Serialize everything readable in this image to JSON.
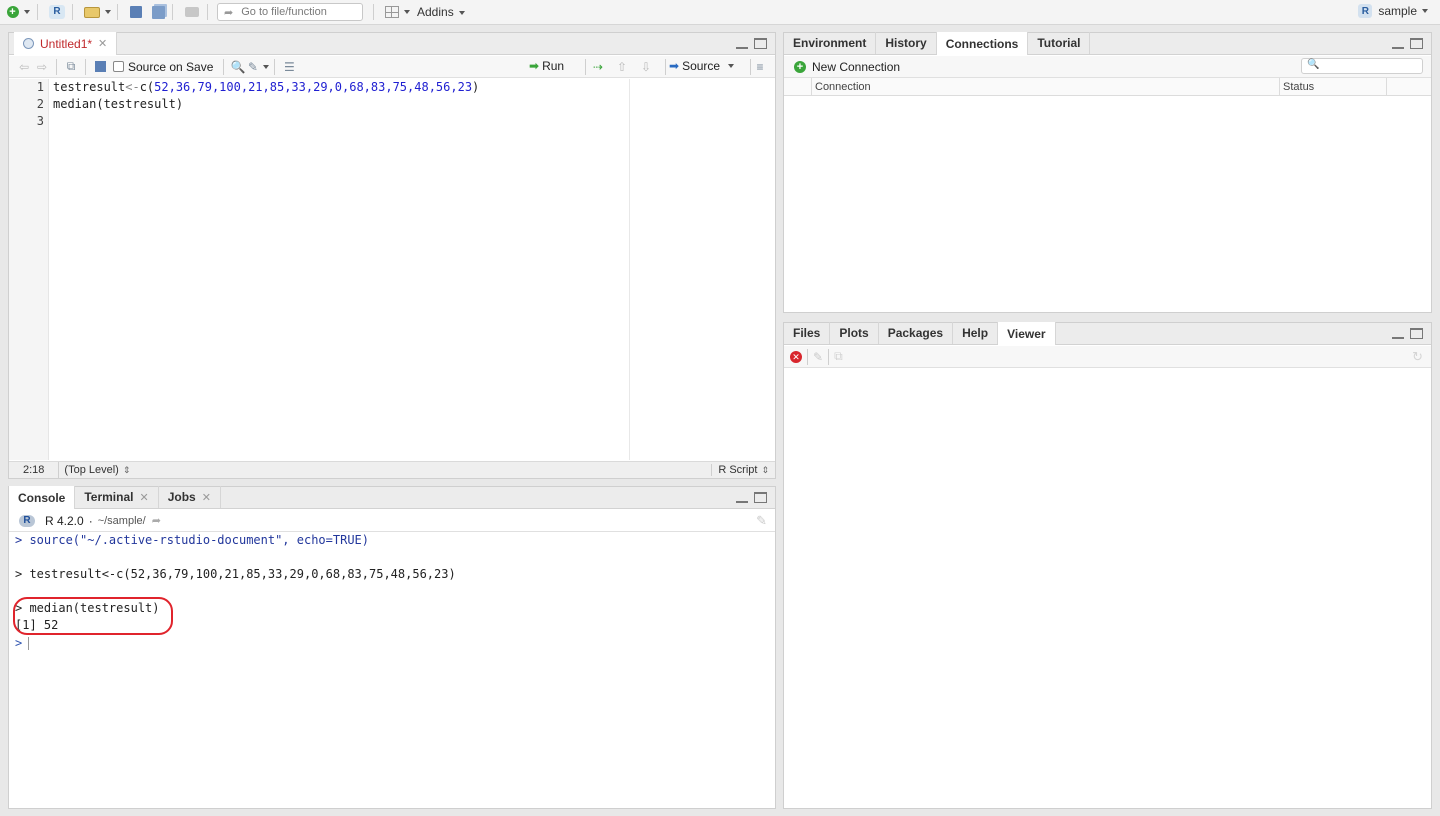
{
  "toolbar": {
    "goto_placeholder": "Go to file/function",
    "addins_label": "Addins",
    "project_label": "sample",
    "project_icon": "R"
  },
  "editor": {
    "tab_label": "Untitled1*",
    "source_on_save_label": "Source on Save",
    "run_label": "Run",
    "source_label": "Source",
    "line_numbers": [
      "1",
      "2",
      "3"
    ],
    "lines": {
      "l1_prefix": "testresult",
      "l1_assign": "<-",
      "l1_fn": "c(",
      "l1_nums": "52,36,79,100,21,85,33,29,0,68,83,75,48,56,23",
      "l1_close": ")",
      "l2": "median(testresult)"
    },
    "status_pos": "2:18",
    "status_scope": "(Top Level)",
    "status_type": "R Script"
  },
  "console": {
    "tabs": [
      "Console",
      "Terminal",
      "Jobs"
    ],
    "r_version": "R 4.2.0",
    "path": "~/sample/",
    "lines": [
      "> source(\"~/.active-rstudio-document\", echo=TRUE)",
      "> testresult<-c(52,36,79,100,21,85,33,29,0,68,83,75,48,56,23)",
      "> median(testresult)",
      "[1] 52",
      ">"
    ]
  },
  "env_pane": {
    "tabs": [
      "Environment",
      "History",
      "Connections",
      "Tutorial"
    ],
    "new_connection_label": "New Connection",
    "col_connection": "Connection",
    "col_status": "Status"
  },
  "files_pane": {
    "tabs": [
      "Files",
      "Plots",
      "Packages",
      "Help",
      "Viewer"
    ]
  },
  "colors": {
    "accent_blue": "#22379c",
    "number_blue": "#1f1fd1",
    "highlight_ring": "#e0242c"
  }
}
